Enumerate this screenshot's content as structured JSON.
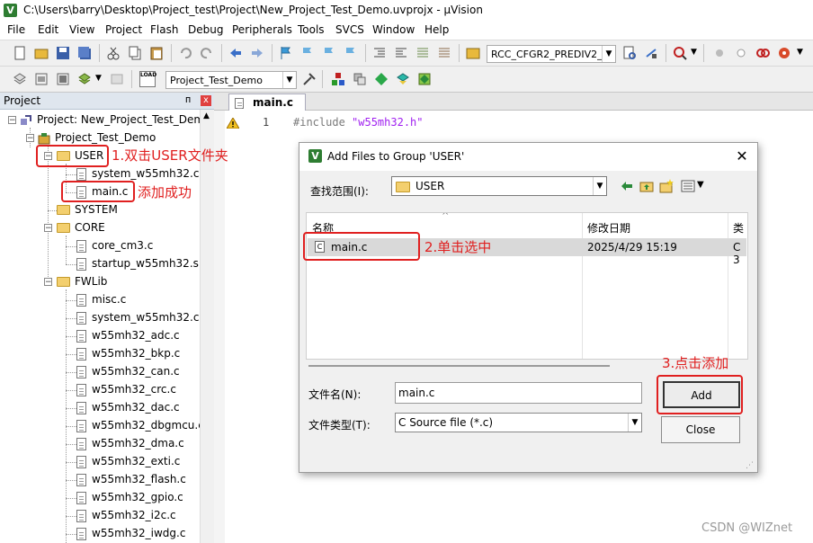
{
  "window": {
    "app_icon": "V",
    "title": "C:\\Users\\barry\\Desktop\\Project_test\\Project\\New_Project_Test_Demo.uvprojx - µVision"
  },
  "menu": [
    "File",
    "Edit",
    "View",
    "Project",
    "Flash",
    "Debug",
    "Peripherals",
    "Tools",
    "SVCS",
    "Window",
    "Help"
  ],
  "toolbar": {
    "define_combo": "RCC_CFGR2_PREDIV2_DIV",
    "target_combo": "Project_Test_Demo",
    "load_label": "LOAD"
  },
  "project_panel": {
    "title": "Project",
    "pin": "ᵖ",
    "close": "x",
    "root": "Project: New_Project_Test_Demo",
    "target": "Project_Test_Demo",
    "groups": {
      "user": "USER",
      "user_files": [
        "system_w55mh32.c",
        "main.c"
      ],
      "system": "SYSTEM",
      "core": "CORE",
      "core_files": [
        "core_cm3.c",
        "startup_w55mh32.s"
      ],
      "fwlib": "FWLib",
      "fwlib_files": [
        "misc.c",
        "system_w55mh32.c",
        "w55mh32_adc.c",
        "w55mh32_bkp.c",
        "w55mh32_can.c",
        "w55mh32_crc.c",
        "w55mh32_dac.c",
        "w55mh32_dbgmcu.c",
        "w55mh32_dma.c",
        "w55mh32_exti.c",
        "w55mh32_flash.c",
        "w55mh32_gpio.c",
        "w55mh32_i2c.c",
        "w55mh32_iwdg.c"
      ]
    }
  },
  "editor": {
    "tab": "main.c",
    "line_number": "1",
    "code": "#include \"w55mh32.h\"",
    "code_keyword": "#include",
    "code_string": "\"w55mh32.h\""
  },
  "dialog": {
    "icon": "V",
    "title": "Add Files to Group 'USER'",
    "close": "✕",
    "look_in_label": "查找范围(I):",
    "look_in_value": "USER",
    "columns": {
      "name": "名称",
      "modified": "修改日期",
      "type": "类"
    },
    "file": {
      "name": "main.c",
      "modified": "2025/4/29 15:19",
      "type": "C 3"
    },
    "file_icon_letter": "C",
    "filename_label": "文件名(N):",
    "filename_value": "main.c",
    "filetype_label": "文件类型(T):",
    "filetype_value": "C Source file (*.c)",
    "add_button": "Add",
    "close_button": "Close"
  },
  "annotations": {
    "step1": "1.双击USER文件夹",
    "added": "添加成功",
    "step2": "2.单击选中",
    "step3": "3.点击添加",
    "color": "#e02020"
  },
  "watermark": "CSDN @WIZnet"
}
